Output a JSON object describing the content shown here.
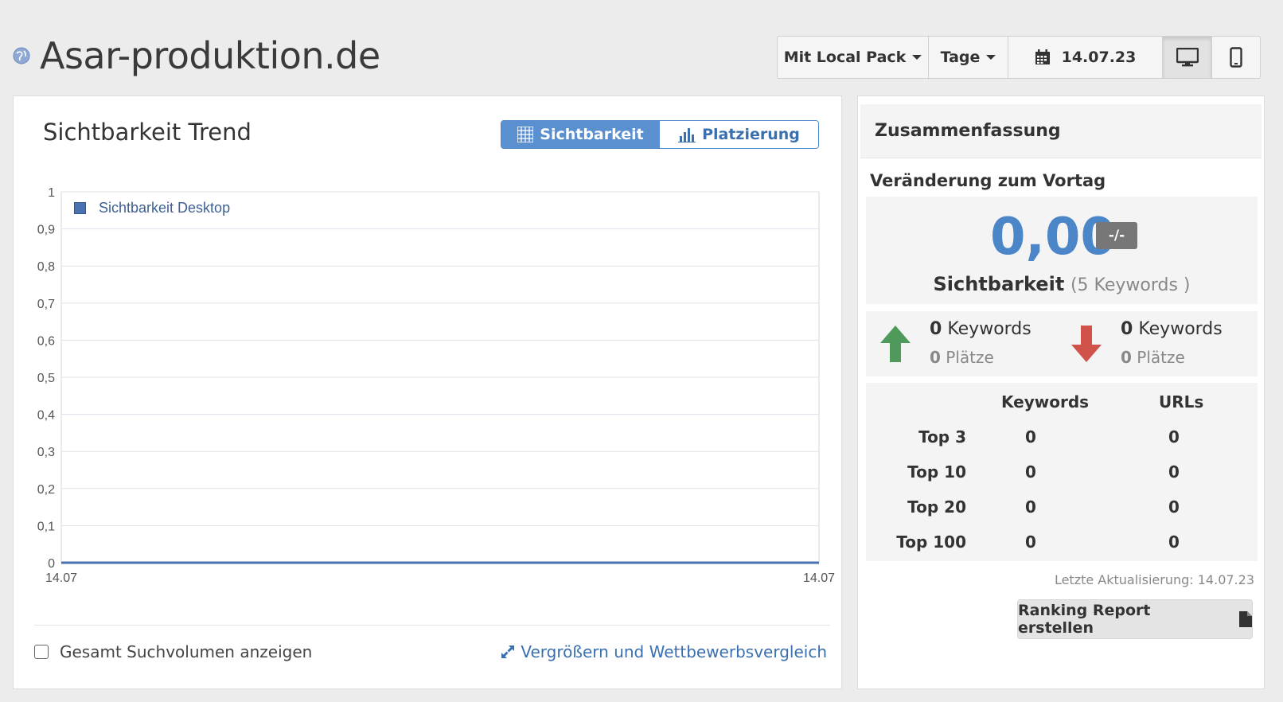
{
  "header": {
    "site_title": "Asar-produktion.de",
    "local_pack_label": "Mit Local Pack",
    "period_label": "Tage",
    "date_label": "14.07.23"
  },
  "trend": {
    "title": "Sichtbarkeit Trend",
    "tab_visibility": "Sichtbarkeit",
    "tab_ranking": "Platzierung",
    "legend_label": "Sichtbarkeit Desktop",
    "checkbox_label": "Gesamt Suchvolumen anzeigen",
    "zoom_link": "Vergrößern und Wettbewerbsvergleich"
  },
  "chart_data": {
    "type": "line",
    "x": [
      "14.07",
      "14.07"
    ],
    "series": [
      {
        "name": "Sichtbarkeit Desktop",
        "values": [
          0,
          0
        ]
      }
    ],
    "ylim": [
      0,
      1
    ],
    "yticks": [
      "0",
      "0,1",
      "0,2",
      "0,3",
      "0,4",
      "0,5",
      "0,6",
      "0,7",
      "0,8",
      "0,9",
      "1"
    ],
    "xticks": [
      "14.07",
      "14.07"
    ],
    "grid": true,
    "legend": "top-left",
    "series_color": "#4a72b0"
  },
  "summary": {
    "title": "Zusammenfassung",
    "change_label": "Veränderung zum Vortag",
    "value": "0,00",
    "badge": "-/-",
    "metric": "Sichtbarkeit",
    "keyword_count": "(5 Keywords )",
    "up": {
      "count": "0",
      "kw_label": "Keywords",
      "places": "0",
      "places_label": "Plätze"
    },
    "down": {
      "count": "0",
      "kw_label": "Keywords",
      "places": "0",
      "places_label": "Plätze"
    },
    "table": {
      "col_keywords": "Keywords",
      "col_urls": "URLs",
      "rows": [
        {
          "label": "Top 3",
          "keywords": "0",
          "urls": "0"
        },
        {
          "label": "Top 10",
          "keywords": "0",
          "urls": "0"
        },
        {
          "label": "Top 20",
          "keywords": "0",
          "urls": "0"
        },
        {
          "label": "Top 100",
          "keywords": "0",
          "urls": "0"
        }
      ]
    },
    "last_update": "Letzte Aktualisierung: 14.07.23",
    "report_button": "Ranking Report erstellen"
  },
  "colors": {
    "accent": "#4a86c8",
    "up": "#4f9a5a",
    "down": "#d0524a"
  }
}
